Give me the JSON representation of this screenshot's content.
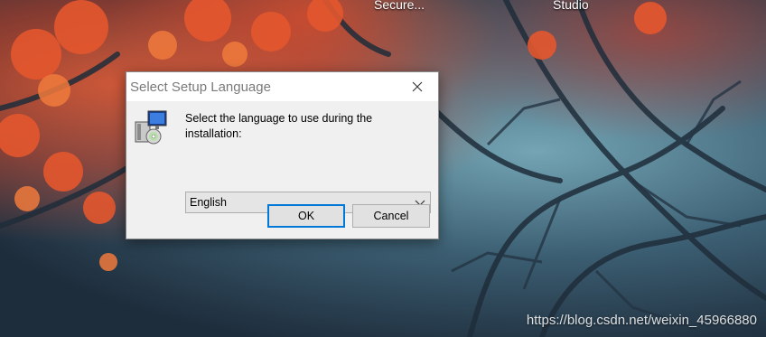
{
  "desktop": {
    "icons": [
      {
        "label": "Secure..."
      },
      {
        "label": "Studio"
      }
    ],
    "watermark": "https://blog.csdn.net/weixin_45966880"
  },
  "dialog": {
    "title": "Select Setup Language",
    "prompt": "Select the language to use during the installation:",
    "language_select": {
      "selected": "English"
    },
    "buttons": {
      "ok": "OK",
      "cancel": "Cancel"
    },
    "accent_color": "#0078d7",
    "icons": {
      "close": "close-icon",
      "setup": "setup-installer-icon",
      "dropdown": "chevron-down-icon"
    }
  }
}
